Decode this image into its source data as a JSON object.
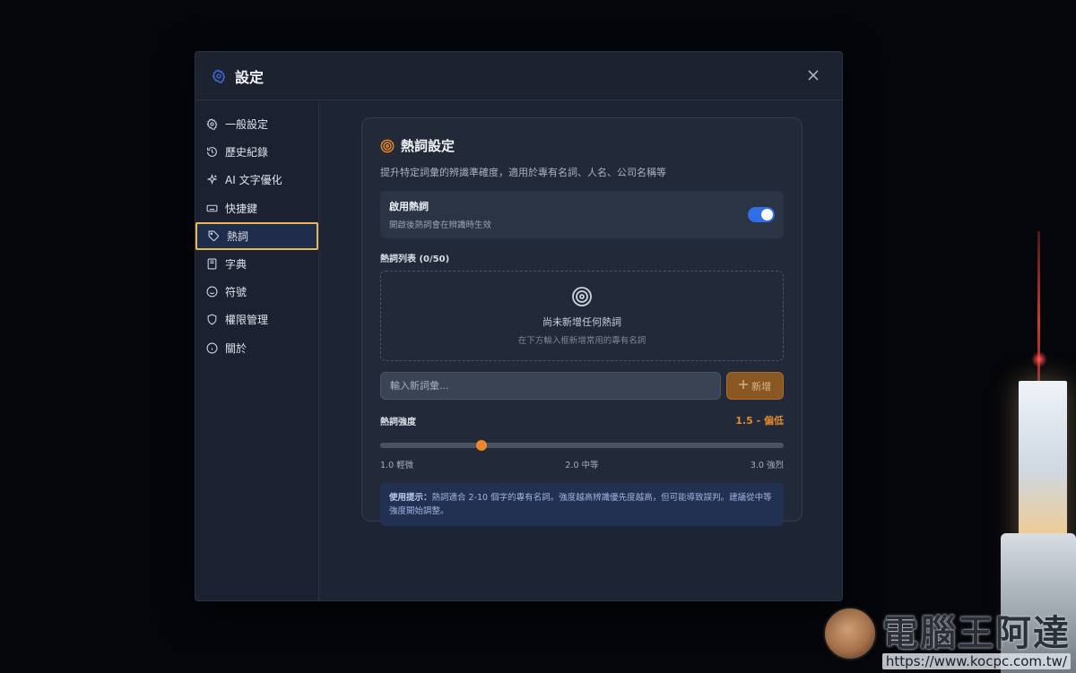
{
  "window": {
    "title": "設定"
  },
  "sidebar": {
    "items": [
      {
        "label": "一般設定",
        "icon": "gear-icon"
      },
      {
        "label": "歷史紀錄",
        "icon": "history-icon"
      },
      {
        "label": "AI 文字優化",
        "icon": "sparkle-icon"
      },
      {
        "label": "快捷鍵",
        "icon": "keyboard-icon"
      },
      {
        "label": "熱詞",
        "icon": "tag-icon",
        "active": true
      },
      {
        "label": "字典",
        "icon": "book-icon"
      },
      {
        "label": "符號",
        "icon": "smile-icon"
      },
      {
        "label": "權限管理",
        "icon": "shield-icon"
      },
      {
        "label": "關於",
        "icon": "info-icon"
      }
    ]
  },
  "hotwords": {
    "title": "熱詞設定",
    "description": "提升特定詞彙的辨識準確度，適用於專有名詞、人名、公司名稱等",
    "toggle": {
      "title": "啟用熱詞",
      "subtitle": "開啟後熱詞會在辨識時生效",
      "enabled": true
    },
    "list_label": "熱詞列表 (0/50)",
    "empty": {
      "title": "尚未新增任何熱詞",
      "subtitle": "在下方輸入框新增常用的專有名詞"
    },
    "input_placeholder": "輸入新詞彙...",
    "add_button": "新增",
    "strength": {
      "label": "熱詞強度",
      "value_text": "1.5 - 偏低",
      "value": 1.5,
      "min": 1.0,
      "max": 3.0,
      "tick_min": "1.0 輕微",
      "tick_mid": "2.0 中等",
      "tick_max": "3.0 強烈"
    },
    "hint": {
      "label": "使用提示：",
      "text": "熱詞適合 2-10 個字的專有名詞。強度越高辨識優先度越高，但可能導致誤判。建議從中等強度開始調整。"
    }
  },
  "watermark": {
    "title": "電腦王阿達",
    "url": "https://www.kocpc.com.tw/"
  },
  "colors": {
    "accent_orange": "#f0852a",
    "toggle_blue": "#2f6ee6",
    "active_border": "#e7b85a"
  }
}
